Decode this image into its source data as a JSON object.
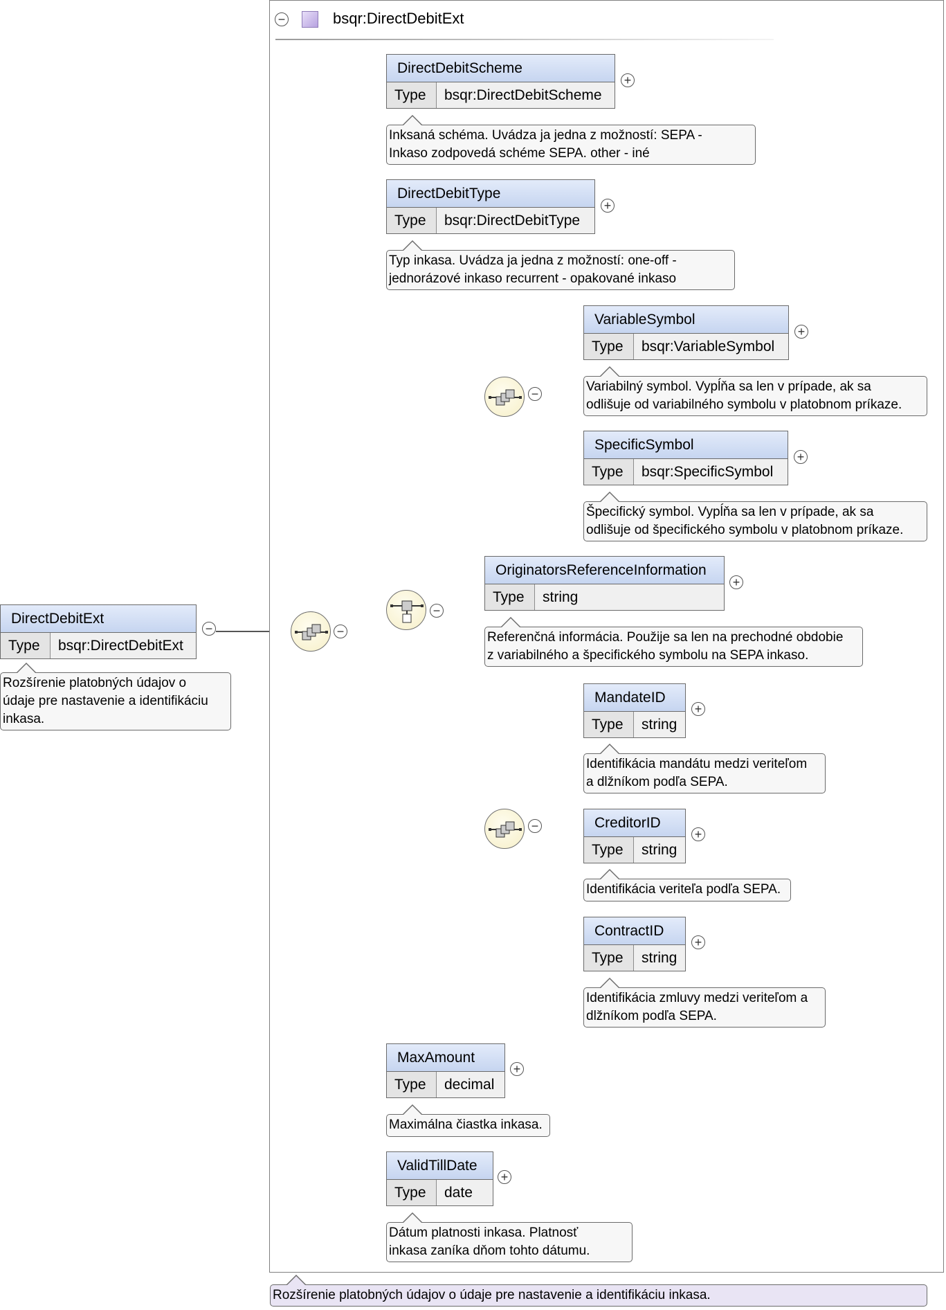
{
  "complex_type": {
    "name": "bsqr:DirectDebitExt",
    "description": "Rozšírenie platobných údajov o údaje pre nastavenie a identifikáciu inkasa."
  },
  "root": {
    "name": "DirectDebitExt",
    "type_label": "Type",
    "type": "bsqr:DirectDebitExt",
    "description": "Rozšírenie platobných údajov o\núdaje pre nastavenie a identifikáciu\ninkasa."
  },
  "elements": {
    "direct_debit_scheme": {
      "name": "DirectDebitScheme",
      "type_label": "Type",
      "type": "bsqr:DirectDebitScheme",
      "description": "Inksaná schéma. Uvádza ja jedna z možností: SEPA -\nInkaso zodpovedá schéme SEPA. other - iné"
    },
    "direct_debit_type": {
      "name": "DirectDebitType",
      "type_label": "Type",
      "type": "bsqr:DirectDebitType",
      "description": "Typ inkasa. Uvádza ja jedna z možností: one-off -\njednorázové inkaso recurrent - opakované inkaso"
    },
    "variable_symbol": {
      "name": "VariableSymbol",
      "type_label": "Type",
      "type": "bsqr:VariableSymbol",
      "description": "Variabilný symbol. Vypĺňa sa len v prípade, ak sa\nodlišuje od variabilného symbolu v platobnom príkaze."
    },
    "specific_symbol": {
      "name": "SpecificSymbol",
      "type_label": "Type",
      "type": "bsqr:SpecificSymbol",
      "description": "Špecifický symbol. Vypĺňa sa len v prípade, ak sa\nodlišuje od špecifického symbolu v platobnom príkaze."
    },
    "originators_reference_information": {
      "name": "OriginatorsReferenceInformation",
      "type_label": "Type",
      "type": "string",
      "description": "Referenčná informácia. Použije sa len na prechodné obdobie\nz variabilného a špecifického symbolu na SEPA inkaso."
    },
    "mandate_id": {
      "name": "MandateID",
      "type_label": "Type",
      "type": "string",
      "description": "Identifikácia mandátu medzi veriteľom\na dlžníkom podľa SEPA."
    },
    "creditor_id": {
      "name": "CreditorID",
      "type_label": "Type",
      "type": "string",
      "description": "Identifikácia veriteľa podľa SEPA."
    },
    "contract_id": {
      "name": "ContractID",
      "type_label": "Type",
      "type": "string",
      "description": "Identifikácia zmluvy medzi veriteľom a\ndlžníkom podľa SEPA."
    },
    "max_amount": {
      "name": "MaxAmount",
      "type_label": "Type",
      "type": "decimal",
      "description": "Maximálna čiastka inkasa."
    },
    "valid_till_date": {
      "name": "ValidTillDate",
      "type_label": "Type",
      "type": "date",
      "description": "Dátum platnosti inkasa. Platnosť\ninkasa zaníka dňom tohto dátumu."
    }
  },
  "controls": {
    "collapse": "−",
    "expand": "+"
  }
}
